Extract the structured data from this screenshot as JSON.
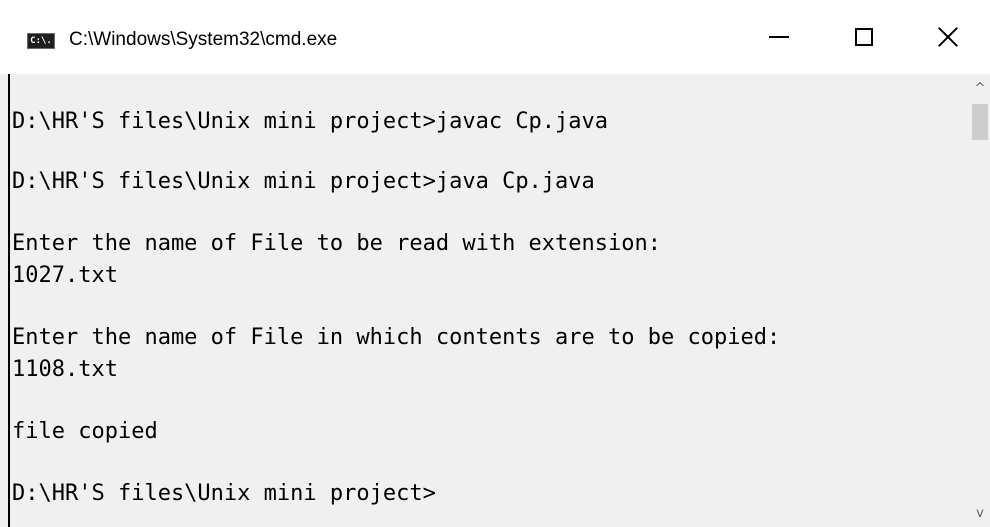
{
  "window": {
    "title": "C:\\Windows\\System32\\cmd.exe",
    "icon": "cmd-icon",
    "icon_text": "C:\\.",
    "controls": {
      "minimize": "minimize-icon",
      "maximize": "maximize-icon",
      "close": "close-icon"
    }
  },
  "console": {
    "lines": [
      "D:\\HR'S files\\Unix mini project>javac Cp.java",
      "D:\\HR'S files\\Unix mini project>java Cp.java",
      "Enter the name of File to be read with extension:",
      "1027.txt",
      "Enter the name of File in which contents are to be copied:",
      "1108.txt",
      "file copied",
      "D:\\HR'S files\\Unix mini project>"
    ]
  },
  "scrollbar": {
    "up_glyph": "^",
    "down_glyph": "v"
  },
  "colors": {
    "titlebar_bg": "#ffffff",
    "console_bg": "#f0f0f0",
    "text": "#000000",
    "scroll_thumb": "#cdcdcd"
  }
}
